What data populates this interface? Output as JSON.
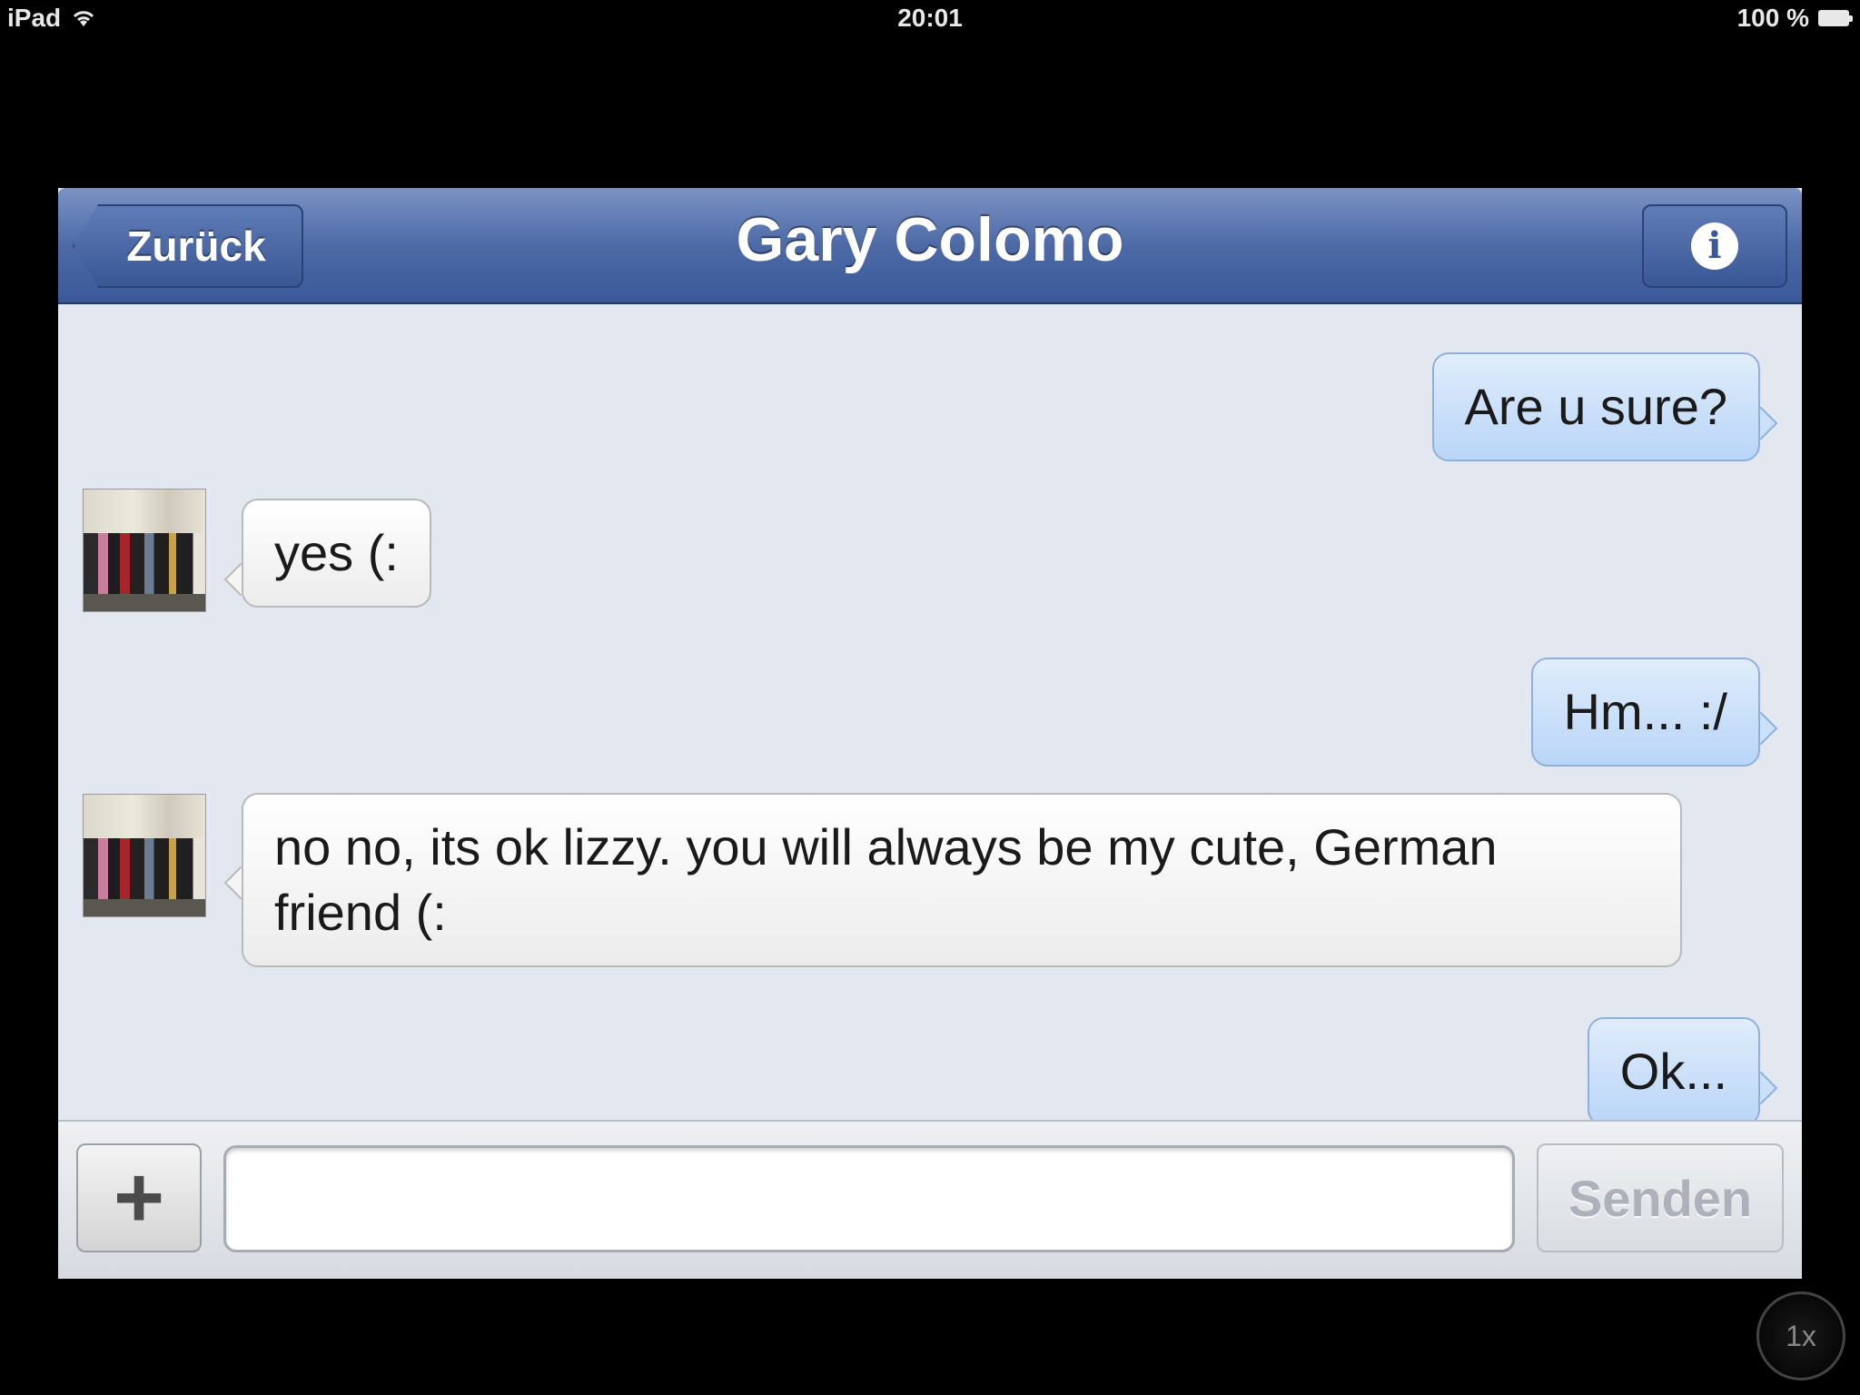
{
  "status_bar": {
    "device": "iPad",
    "time": "20:01",
    "battery": "100 %"
  },
  "nav": {
    "back_label": "Zurück",
    "title": "Gary Colomo",
    "info_icon": "i"
  },
  "messages": {
    "m1": "Are u sure?",
    "m2": "yes (:",
    "m3": "Hm... :/",
    "m4_line1": "no no, its ok lizzy. you will always be my cute, German",
    "m4_line2": "friend (:",
    "m5": "Ok..."
  },
  "composer": {
    "add_label": "+",
    "input_value": "",
    "input_placeholder": "",
    "send_label": "Senden"
  },
  "zoom": {
    "label": "1x"
  },
  "colors": {
    "navbar": "#3b5998",
    "outgoing_bubble": "#b9d5f7",
    "incoming_bubble": "#ffffff",
    "background": "#e3e7ef"
  }
}
